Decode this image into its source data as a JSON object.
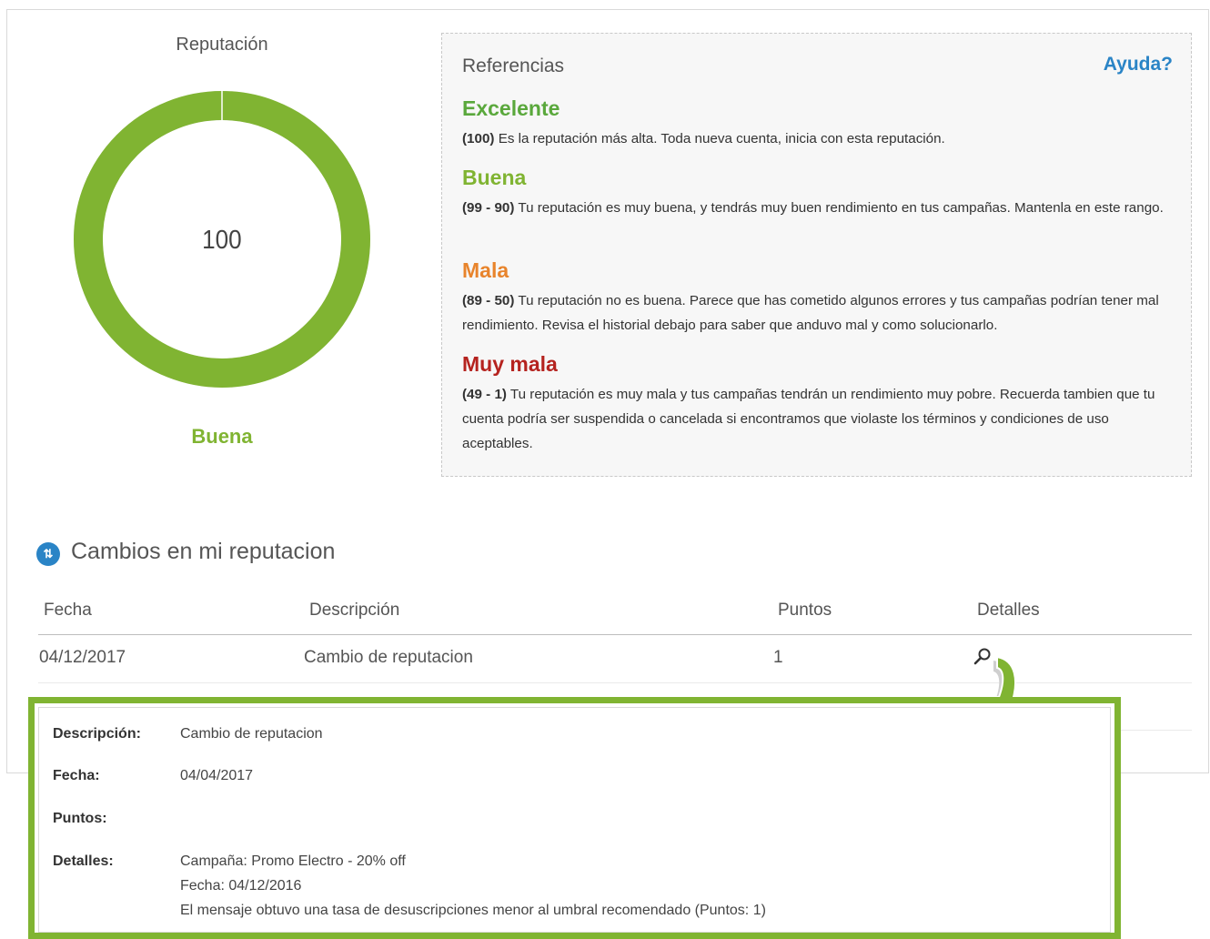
{
  "reputation": {
    "title": "Reputación",
    "score": "100",
    "status": "Buena",
    "status_color": "#80b432",
    "ring_color": "#80b432",
    "fill_fraction": 1.0
  },
  "references": {
    "title": "Referencias",
    "help_label": "Ayuda?",
    "items": [
      {
        "level": "Excelente",
        "color": "#5aa83c",
        "range": "(100)",
        "text": " Es la reputación más alta. Toda nueva cuenta, inicia con esta reputación."
      },
      {
        "level": "Buena",
        "color": "#80b432",
        "range": "(99 - 90)",
        "text": " Tu reputación es muy buena, y tendrás muy buen rendimiento en tus campañas. Mantenla en este rango."
      },
      {
        "level": "Mala",
        "color": "#e8842c",
        "range": "(89 - 50)",
        "text": " Tu reputación no es buena. Parece que has cometido algunos errores y tus campañas podrían tener mal rendimiento. Revisa el historial debajo para saber que anduvo mal y como solucionarlo."
      },
      {
        "level": "Muy mala",
        "color": "#b5231f",
        "range": "(49 - 1)",
        "text": " Tu reputación es muy mala y tus campañas tendrán un rendimiento muy pobre. Recuerda tambien que tu cuenta podría ser suspendida o cancelada si encontramos que violaste los términos y condiciones de uso aceptables."
      }
    ]
  },
  "changes": {
    "section_icon": "sort-icon",
    "title": "Cambios en mi reputacion",
    "columns": [
      "Fecha",
      "Descripción",
      "Puntos",
      "Detalles"
    ],
    "rows": [
      {
        "date": "04/12/2017",
        "description": "Cambio de reputacion",
        "points": "1",
        "details_icon": "magnifier-icon"
      }
    ]
  },
  "detail_panel": {
    "description_label": "Descripción:",
    "description_value": "Cambio de reputacion",
    "date_label": "Fecha:",
    "date_value": "04/04/2017",
    "points_label": "Puntos:",
    "points_value": "",
    "details_label": "Detalles:",
    "details_lines": [
      "Campaña: Promo Electro - 20% off",
      "Fecha: 04/12/2016",
      "El mensaje obtuvo una tasa de desuscripciones menor al umbral recomendado (Puntos: 1)"
    ],
    "border_color": "#80b432"
  }
}
